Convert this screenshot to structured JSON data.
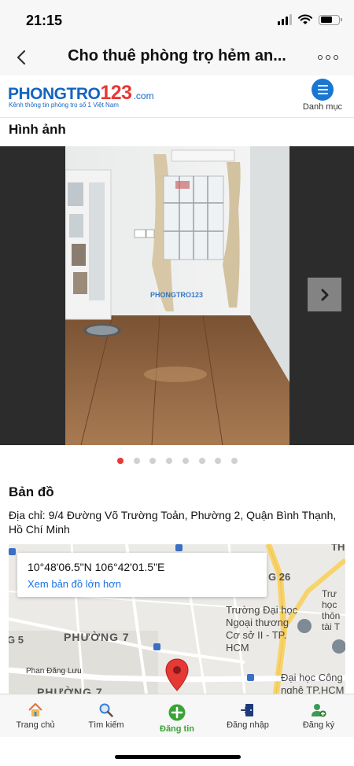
{
  "status_bar": {
    "time": "21:15"
  },
  "nav": {
    "title": "Cho thuê phòng trọ hẻm an..."
  },
  "site": {
    "logo_main": "PHONGTRO",
    "logo_num": "123",
    "logo_suffix": ".com",
    "tagline": "Kênh thông tin phòng trọ số 1 Việt Nam",
    "menu_label": "Danh mục"
  },
  "gallery": {
    "title": "Hình ảnh",
    "watermark": "PHONGTRO123",
    "dot_count": 8,
    "active_index": 0
  },
  "map_section": {
    "title": "Bản đồ",
    "address": "Địa chỉ: 9/4 Đường Võ Trường Toản, Phường 2, Quận Bình Thạnh, Hồ Chí Minh",
    "coordinates": "10°48'06.5\"N 106°42'01.5\"E",
    "larger_map_link": "Xem bản đồ lớn hơn",
    "labels": {
      "street": "Phan Đăng Lưu",
      "ward7": "PHƯỜNG 7",
      "ward7b": "PHƯỜNG 7",
      "ward5": "G 5",
      "ward26": "G 26",
      "university": "Trường Đại học Ngoại thương Cơ sở II - TP. HCM",
      "university2": "Đại học Công nghệ TP.HCM",
      "right_top": "Trư học thôn tài T",
      "top_right": "TH"
    }
  },
  "tabs": [
    {
      "label": "Trang chủ",
      "icon": "home-icon"
    },
    {
      "label": "Tìm kiếm",
      "icon": "search-icon"
    },
    {
      "label": "Đăng tin",
      "icon": "add-post-icon"
    },
    {
      "label": "Đăng nhập",
      "icon": "login-icon"
    },
    {
      "label": "Đăng ký",
      "icon": "register-icon"
    }
  ],
  "colors": {
    "brand_blue": "#1565c0",
    "brand_red": "#e53935",
    "post_green": "#3aa336",
    "link_blue": "#1a73e8"
  }
}
